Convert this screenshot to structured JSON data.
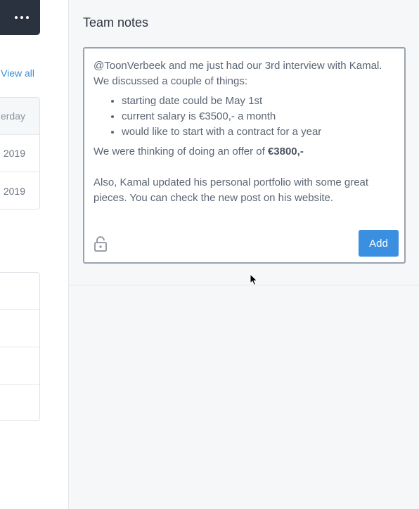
{
  "left": {
    "view_all_label": "View all",
    "date_rows": [
      "erday",
      "2019",
      "2019"
    ]
  },
  "notes": {
    "title": "Team notes",
    "intro": "@ToonVerbeek and me just had our 3rd interview with Kamal. We discussed a couple of things:",
    "bullets": [
      "starting date could be May 1st",
      "current salary is €3500,- a month",
      "would like to start with a contract for a year"
    ],
    "offer_prefix": "We were thinking of doing an offer of ",
    "offer_amount": "€3800,-",
    "footer": "Also, Kamal updated his personal portfolio with some great pieces. You can check the new post on his website.",
    "add_label": "Add"
  },
  "icons": {
    "more": "more-dots-icon",
    "lock": "lock-icon",
    "cursor": "mouse-cursor-icon"
  },
  "colors": {
    "accent": "#3a8fe0",
    "dark_button": "#2a3240",
    "link": "#3a8fd6"
  }
}
